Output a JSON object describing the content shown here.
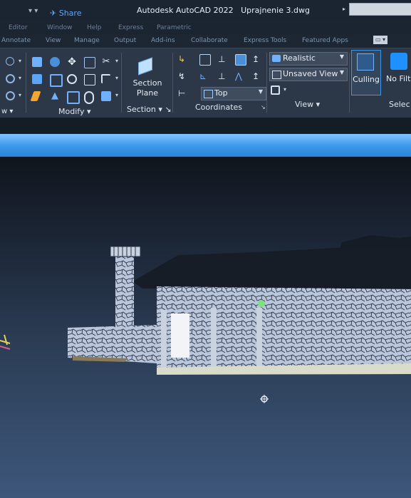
{
  "titlebar": {
    "quick_access": "▾ ▾",
    "share": "Share",
    "app_name": "Autodesk AutoCAD 2022",
    "file_name": "Uprajnenie 3.dwg"
  },
  "menu": [
    "Editor",
    "Window",
    "Help",
    "Express",
    "Parametric"
  ],
  "tabs": [
    "Annotate",
    "View",
    "Manage",
    "Output",
    "Add-ins",
    "Collaborate",
    "Express Tools",
    "Featured Apps"
  ],
  "ribbon": {
    "modify_label": "Modify",
    "section_button": [
      "Section",
      "Plane"
    ],
    "section_label": "Section",
    "coordinates_label": "Coordinates",
    "ucs_select": "Top",
    "visual_style": "Realistic",
    "named_view": "Unsaved View",
    "view_label": "View",
    "culling": "Culling",
    "no_filter": "No Filt",
    "selection_label": "Selec"
  },
  "colors": {
    "ribbon_bg": "#2c3848",
    "titlebar_bg": "#1b2431",
    "accent": "#3b97e9",
    "viewport_bottom": "#3d577b"
  }
}
